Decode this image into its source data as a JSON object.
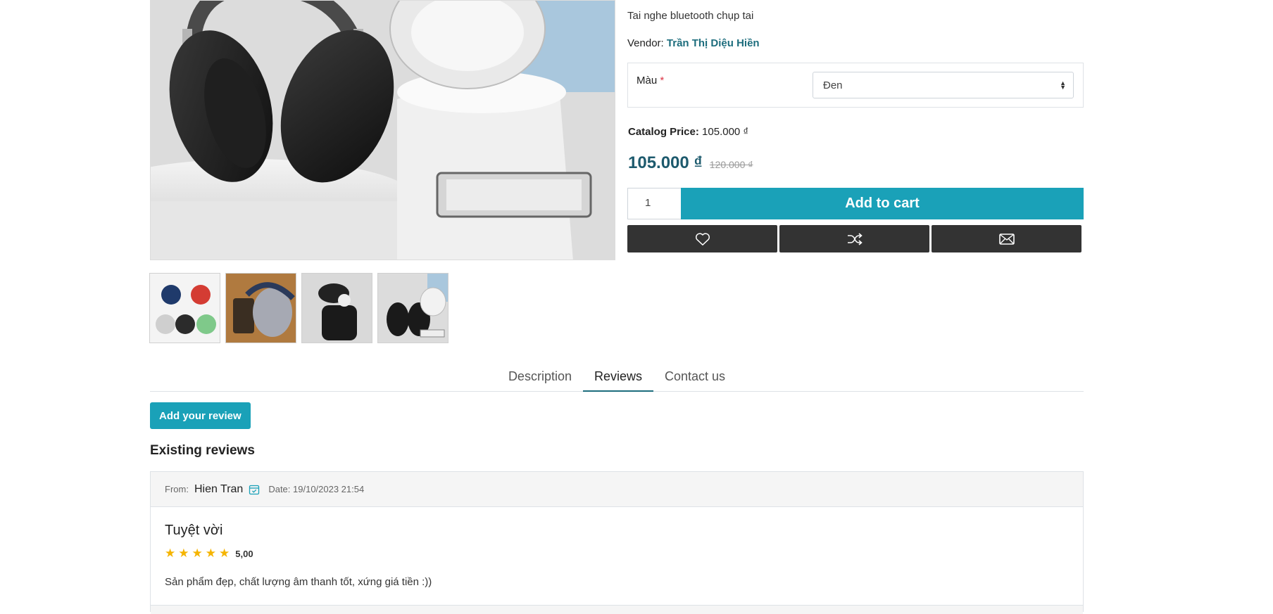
{
  "product": {
    "short_description": "Tai nghe bluetooth chụp tai",
    "vendor_label": "Vendor:",
    "vendor_name": "Trần Thị Diệu Hiền",
    "attribute_label": "Màu",
    "attribute_required": "*",
    "attribute_selected": "Đen",
    "catalog_price_label": "Catalog Price:",
    "catalog_price_value": "105.000 ₫",
    "price_current": "105.000 ₫",
    "price_old": "120.000 ₫",
    "quantity": "1",
    "add_to_cart_label": "Add to cart",
    "actions": [
      {
        "icon": "heart-icon"
      },
      {
        "icon": "shuffle-icon"
      },
      {
        "icon": "envelope-icon"
      }
    ],
    "thumbnails": [
      {
        "name": "thumbnail-colors"
      },
      {
        "name": "thumbnail-box"
      },
      {
        "name": "thumbnail-model"
      },
      {
        "name": "thumbnail-pair"
      }
    ]
  },
  "tabs": [
    {
      "label": "Description",
      "active": false
    },
    {
      "label": "Reviews",
      "active": true
    },
    {
      "label": "Contact us",
      "active": false
    }
  ],
  "reviews": {
    "add_label": "Add your review",
    "existing_title": "Existing reviews",
    "items": [
      {
        "from_label": "From:",
        "author": "Hien Tran",
        "date_label": "Date: 19/10/2023 21:54",
        "title": "Tuyệt vời",
        "rating": 5,
        "rating_text": "5,00",
        "text": "Sản phẩm đẹp, chất lượng âm thanh tốt, xứng giá tiền :))"
      }
    ]
  },
  "colors": {
    "accent": "#1aa1b8",
    "price": "#1d5a6d",
    "action_bg": "#333333",
    "star": "#f5b400"
  }
}
